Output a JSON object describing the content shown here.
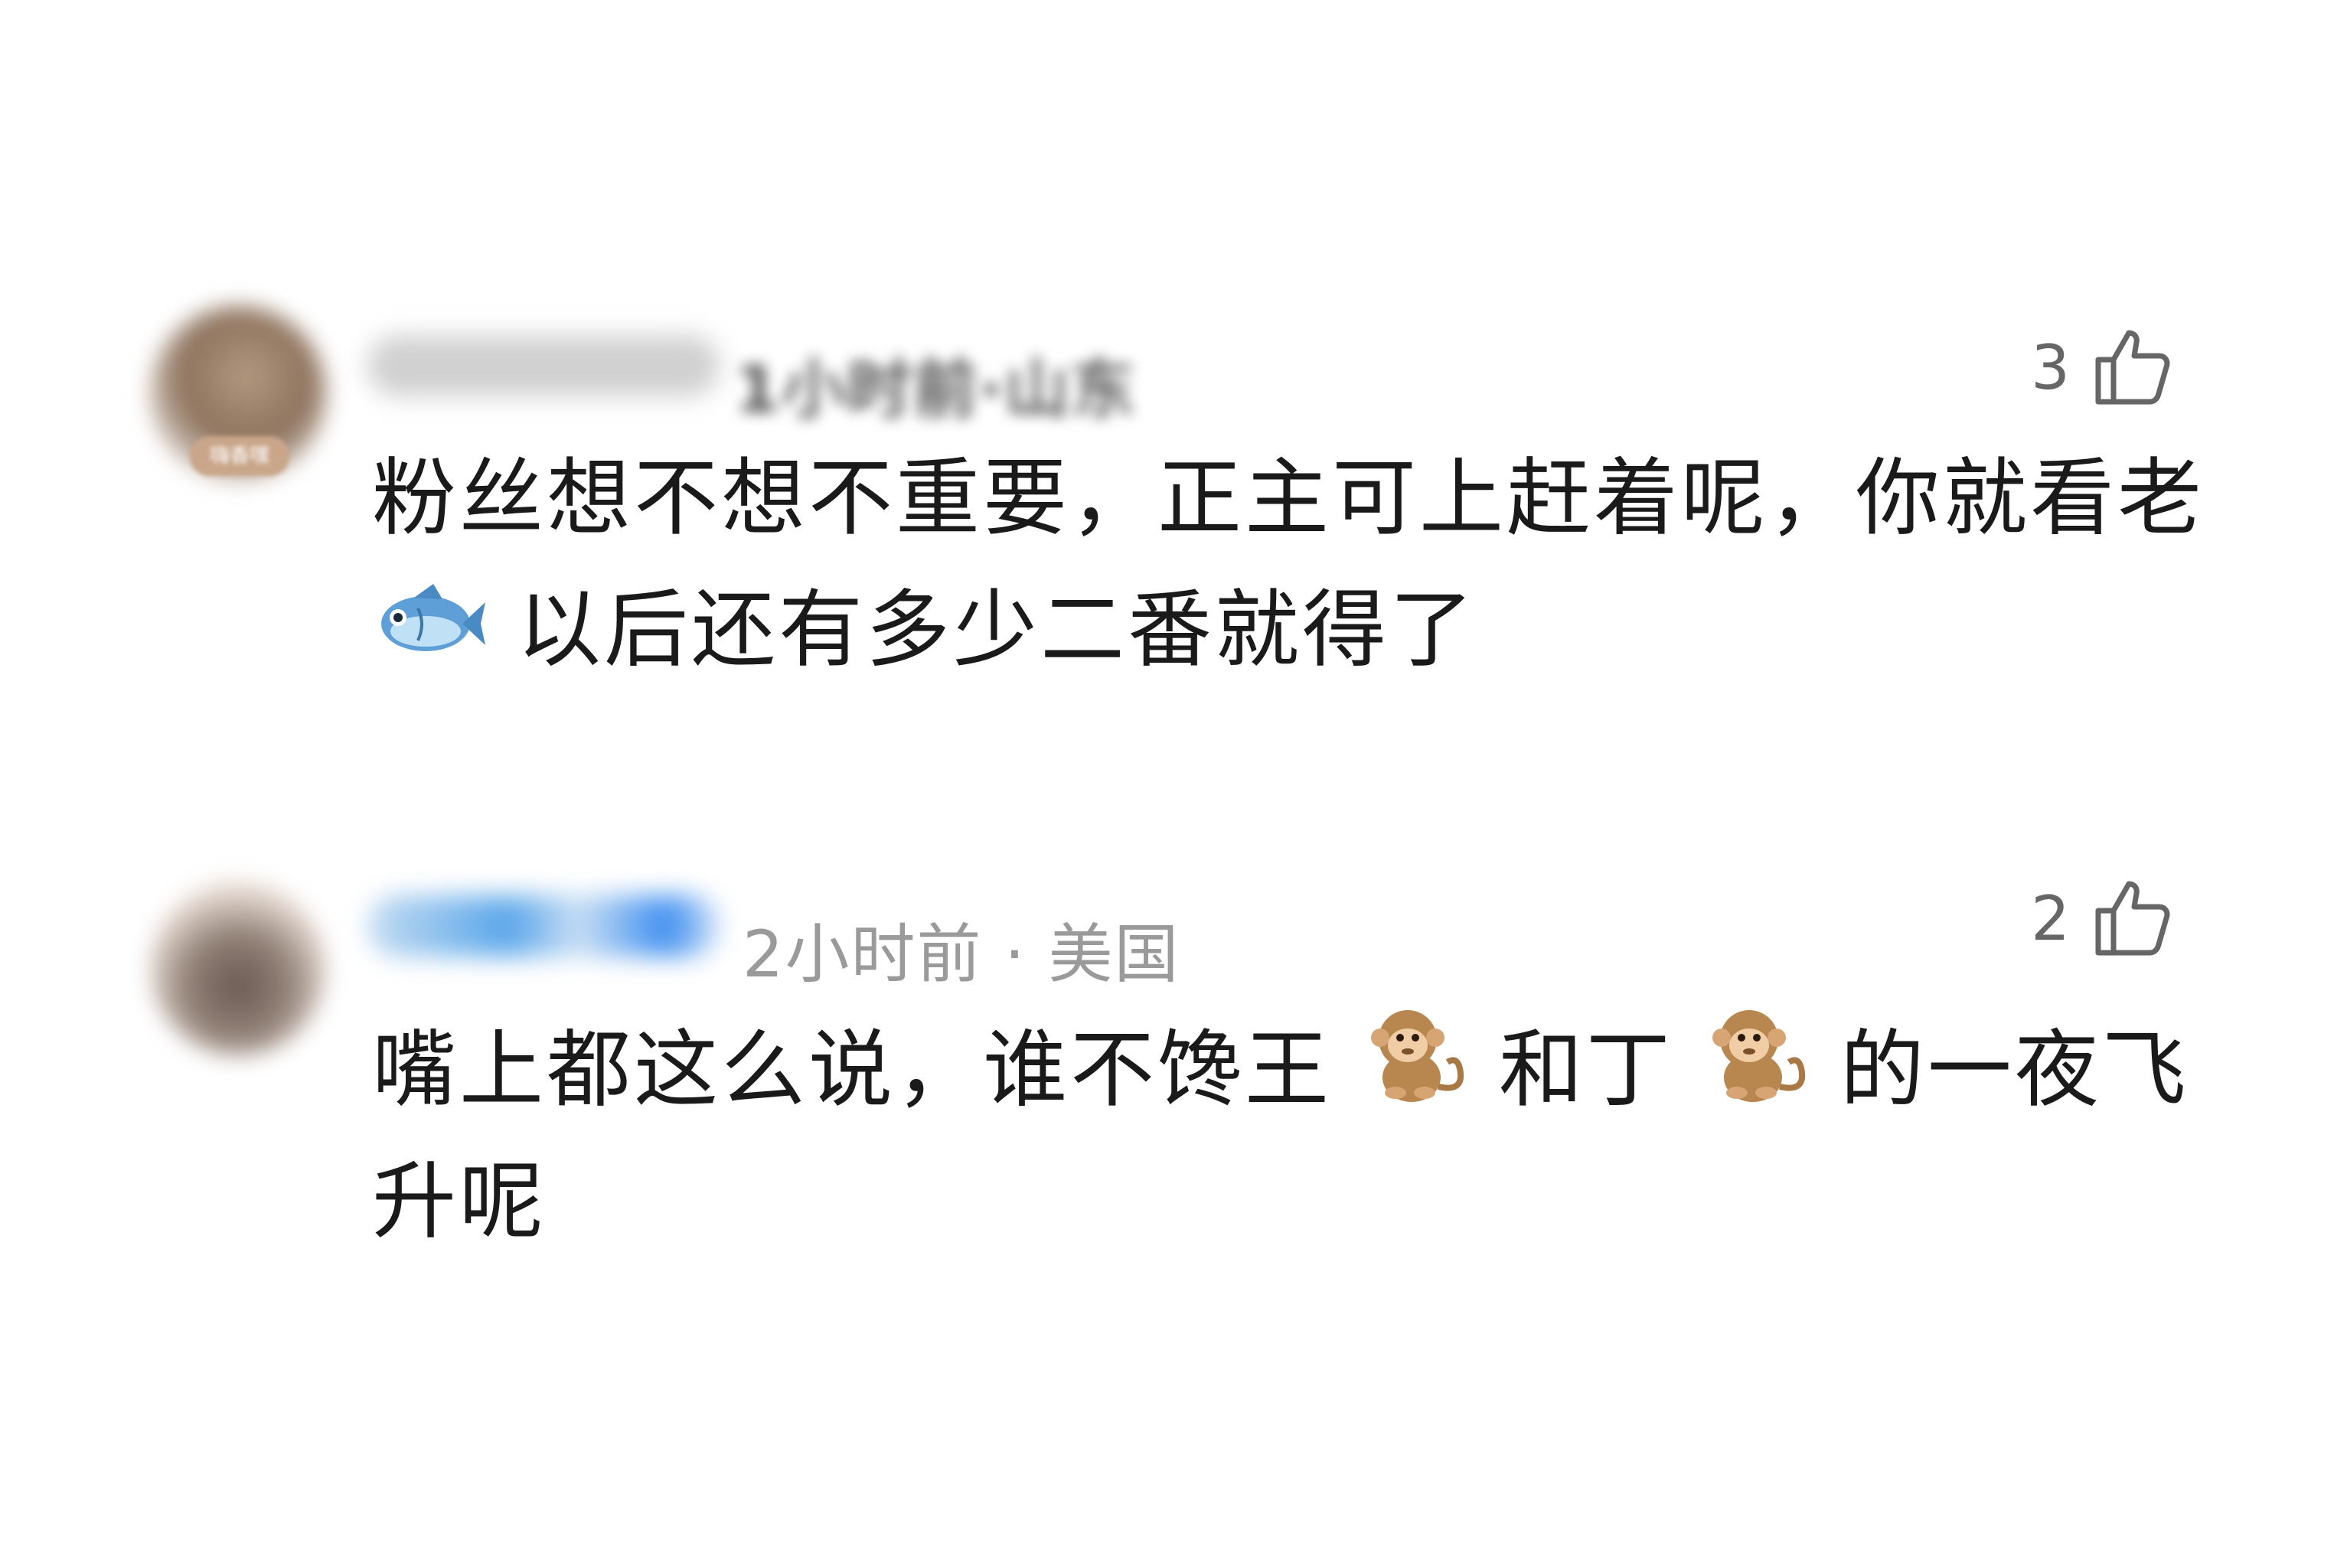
{
  "comments": [
    {
      "author_meta": "1小时前·山东",
      "like_count": "3",
      "avatar_badge": "嗨香嘿",
      "text_part1": "粉丝想不想不重要，正主可上赶着呢，你就看老",
      "emoji1": "fish-icon",
      "text_part2": "以后还有多少二番就得了"
    },
    {
      "author_meta": "2小时前 · 美国",
      "like_count": "2",
      "text_part1": "嘴上都这么说，谁不馋王",
      "emoji1": "monkey-icon",
      "text_part2": "和丁",
      "emoji2": "monkey-icon",
      "text_part3": "的一夜飞升呢"
    }
  ],
  "colors": {
    "text": "#1a1a1a",
    "meta": "#9a9a9a",
    "like": "#666666"
  }
}
